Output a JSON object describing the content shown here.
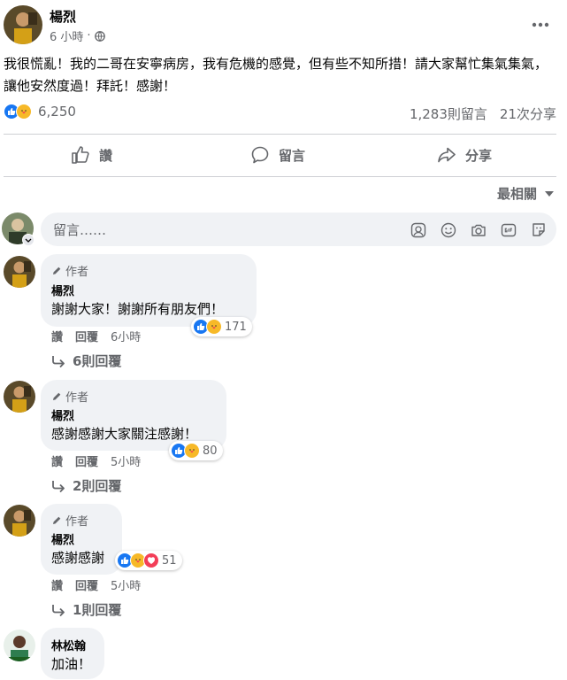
{
  "post": {
    "author": "楊烈",
    "time": "6 小時",
    "body": "我很慌亂！我的二哥在安寧病房，我有危機的感覺，但有些不知所措！請大家幫忙集氣集氣，讓他安然度過！拜託！感謝！",
    "reaction_count": "6,250",
    "comment_count": "1,283則留言",
    "share_count": "21次分享"
  },
  "actions": {
    "like": "讚",
    "comment": "留言",
    "share": "分享"
  },
  "sort_label": "最相關",
  "composer": {
    "placeholder": "留言……"
  },
  "comments": [
    {
      "badge": "作者",
      "name": "楊烈",
      "text": "謝謝大家！謝謝所有朋友們！",
      "like": "讚",
      "reply": "回覆",
      "time": "6小時",
      "reactions": "171",
      "replies": "6則回覆"
    },
    {
      "badge": "作者",
      "name": "楊烈",
      "text": "感謝感謝大家關注感謝！",
      "like": "讚",
      "reply": "回覆",
      "time": "5小時",
      "reactions": "80",
      "replies": "2則回覆"
    },
    {
      "badge": "作者",
      "name": "楊烈",
      "text": "感謝感謝",
      "like": "讚",
      "reply": "回覆",
      "time": "5小時",
      "reactions": "51",
      "replies": "1則回覆"
    },
    {
      "name": "林松翰",
      "text": "加油！"
    }
  ],
  "colors": {
    "accent": "#1877f2",
    "bubble": "#f0f2f5",
    "muted": "#65676b"
  }
}
